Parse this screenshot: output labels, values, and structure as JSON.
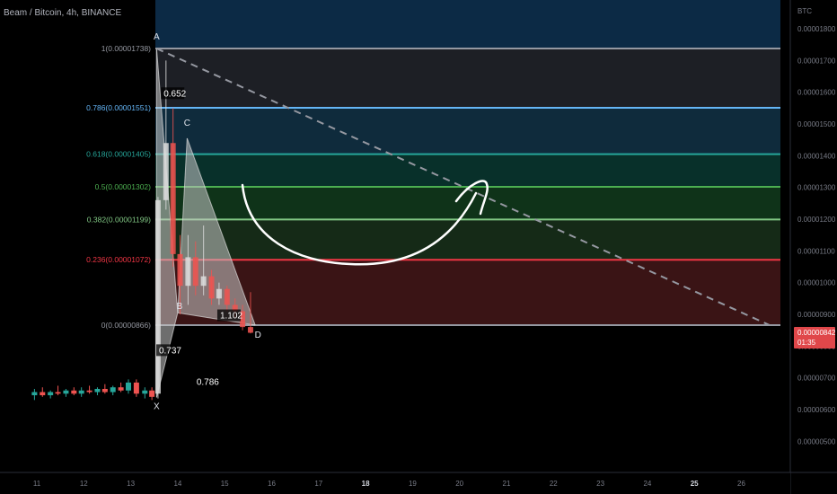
{
  "header": {
    "title": "Beam / Bitcoin, 4h, BINANCE",
    "currency": "BTC"
  },
  "price_badge": {
    "value": "0.00000842",
    "countdown": "01:35"
  },
  "chart_data": {
    "type": "candlestick",
    "title": "Beam / Bitcoin, 4h, BINANCE",
    "y_axis": {
      "unit": "BTC",
      "range": [
        4.5e-06,
        1.91e-05
      ],
      "ticks": [
        "0.00001800",
        "0.00001700",
        "0.00001600",
        "0.00001500",
        "0.00001400",
        "0.00001300",
        "0.00001200",
        "0.00001100",
        "0.00001000",
        "0.00000900",
        "0.00000800",
        "0.00000700",
        "0.00000600",
        "0.00000500"
      ],
      "tick_values": [
        1.8e-05,
        1.7e-05,
        1.6e-05,
        1.5e-05,
        1.4e-05,
        1.3e-05,
        1.2e-05,
        1.1e-05,
        1e-05,
        9e-06,
        8e-06,
        7e-06,
        6e-06,
        5e-06
      ]
    },
    "x_axis": {
      "ticks": [
        "11",
        "12",
        "13",
        "14",
        "15",
        "16",
        "17",
        "18",
        "19",
        "20",
        "21",
        "22",
        "23",
        "24",
        "25",
        "26"
      ],
      "bold_ticks": [
        "18",
        "25"
      ]
    },
    "fib_levels": [
      {
        "ratio": "1",
        "label": "1(0.00001738)",
        "price": 1.738e-05,
        "color": "#9598a1"
      },
      {
        "ratio": "0.786",
        "label": "0.786(0.00001551)",
        "price": 1.551e-05,
        "color": "#64b5f6"
      },
      {
        "ratio": "0.618",
        "label": "0.618(0.00001405)",
        "price": 1.405e-05,
        "color": "#26a69a"
      },
      {
        "ratio": "0.5",
        "label": "0.5(0.00001302)",
        "price": 1.302e-05,
        "color": "#4caf50"
      },
      {
        "ratio": "0.382",
        "label": "0.382(0.00001199)",
        "price": 1.199e-05,
        "color": "#81c784"
      },
      {
        "ratio": "0.236",
        "label": "0.236(0.00001072)",
        "price": 1.072e-05,
        "color": "#f23645"
      },
      {
        "ratio": "0",
        "label": "0(0.00000866)",
        "price": 8.66e-06,
        "color": "#9598a1"
      }
    ],
    "fib_zones": [
      {
        "from": 1.738e-05,
        "to": 1.91e-05,
        "color": "#0c2a45"
      },
      {
        "from": 1.551e-05,
        "to": 1.738e-05,
        "color": "#1d1f25"
      },
      {
        "from": 1.405e-05,
        "to": 1.551e-05,
        "color": "#0f2b3c"
      },
      {
        "from": 1.302e-05,
        "to": 1.405e-05,
        "color": "#08302a"
      },
      {
        "from": 1.199e-05,
        "to": 1.302e-05,
        "color": "#0f3319"
      },
      {
        "from": 1.072e-05,
        "to": 1.199e-05,
        "color": "#152a17"
      },
      {
        "from": 8.66e-06,
        "to": 1.072e-05,
        "color": "#3a1415"
      }
    ],
    "harmonic_pattern": {
      "points": [
        {
          "label": "X",
          "x": 13.55,
          "price": 6.38e-06
        },
        {
          "label": "A",
          "x": 13.55,
          "price": 1.738e-05
        },
        {
          "label": "B",
          "x": 14.0,
          "price": 9.05e-06
        },
        {
          "label": "C",
          "x": 14.2,
          "price": 1.455e-05
        },
        {
          "label": "D",
          "x": 15.65,
          "price": 8.66e-06
        }
      ],
      "ratios": [
        {
          "text": "0.652",
          "x": 13.7,
          "price": 1.59e-05
        },
        {
          "text": "0.737",
          "x": 13.6,
          "price": 7.8e-06
        },
        {
          "text": "0.786",
          "x": 14.4,
          "price": 6.8e-06
        },
        {
          "text": "1.102",
          "x": 14.9,
          "price": 8.9e-06
        }
      ]
    },
    "dashed_trendline": {
      "from": {
        "x": 13.55,
        "price": 1.738e-05
      },
      "to": {
        "x": 26.6,
        "price": 8.66e-06
      }
    },
    "candles": [
      {
        "x": 10.95,
        "o": 6.45,
        "h": 6.65,
        "l": 6.3,
        "c": 6.55
      },
      {
        "x": 11.12,
        "o": 6.55,
        "h": 6.7,
        "l": 6.4,
        "c": 6.45
      },
      {
        "x": 11.29,
        "o": 6.45,
        "h": 6.6,
        "l": 6.35,
        "c": 6.55
      },
      {
        "x": 11.45,
        "o": 6.55,
        "h": 6.75,
        "l": 6.45,
        "c": 6.5
      },
      {
        "x": 11.62,
        "o": 6.5,
        "h": 6.65,
        "l": 6.4,
        "c": 6.6
      },
      {
        "x": 11.79,
        "o": 6.6,
        "h": 6.7,
        "l": 6.45,
        "c": 6.5
      },
      {
        "x": 11.95,
        "o": 6.5,
        "h": 6.7,
        "l": 6.4,
        "c": 6.6
      },
      {
        "x": 12.12,
        "o": 6.6,
        "h": 6.75,
        "l": 6.5,
        "c": 6.55
      },
      {
        "x": 12.29,
        "o": 6.55,
        "h": 6.7,
        "l": 6.45,
        "c": 6.65
      },
      {
        "x": 12.45,
        "o": 6.65,
        "h": 6.8,
        "l": 6.5,
        "c": 6.55
      },
      {
        "x": 12.62,
        "o": 6.55,
        "h": 6.75,
        "l": 6.45,
        "c": 6.7
      },
      {
        "x": 12.79,
        "o": 6.7,
        "h": 6.85,
        "l": 6.55,
        "c": 6.6
      },
      {
        "x": 12.95,
        "o": 6.6,
        "h": 6.95,
        "l": 6.5,
        "c": 6.85
      },
      {
        "x": 13.12,
        "o": 6.85,
        "h": 6.95,
        "l": 6.4,
        "c": 6.5
      },
      {
        "x": 13.3,
        "o": 6.5,
        "h": 6.7,
        "l": 6.35,
        "c": 6.6
      },
      {
        "x": 13.45,
        "o": 6.6,
        "h": 6.7,
        "l": 6.3,
        "c": 6.4
      },
      {
        "x": 13.58,
        "o": 6.5,
        "h": 12.7,
        "l": 6.35,
        "c": 12.6
      },
      {
        "x": 13.75,
        "o": 12.6,
        "h": 17.0,
        "l": 12.3,
        "c": 14.4
      },
      {
        "x": 13.9,
        "o": 14.4,
        "h": 15.5,
        "l": 10.5,
        "c": 10.9
      },
      {
        "x": 14.05,
        "o": 10.9,
        "h": 11.5,
        "l": 9.0,
        "c": 9.9
      },
      {
        "x": 14.22,
        "o": 9.9,
        "h": 11.5,
        "l": 9.3,
        "c": 10.8
      },
      {
        "x": 14.38,
        "o": 10.8,
        "h": 11.3,
        "l": 9.6,
        "c": 9.9
      },
      {
        "x": 14.55,
        "o": 9.9,
        "h": 11.8,
        "l": 9.6,
        "c": 10.2
      },
      {
        "x": 14.72,
        "o": 10.2,
        "h": 10.4,
        "l": 9.3,
        "c": 9.5
      },
      {
        "x": 14.88,
        "o": 9.5,
        "h": 10.0,
        "l": 9.3,
        "c": 9.8
      },
      {
        "x": 15.05,
        "o": 9.8,
        "h": 9.9,
        "l": 9.1,
        "c": 9.3
      },
      {
        "x": 15.22,
        "o": 9.3,
        "h": 9.5,
        "l": 8.9,
        "c": 9.1
      },
      {
        "x": 15.38,
        "o": 9.1,
        "h": 9.3,
        "l": 8.5,
        "c": 8.6
      },
      {
        "x": 15.55,
        "o": 8.6,
        "h": 9.7,
        "l": 8.4,
        "c": 8.42
      }
    ],
    "price_scale_factor": 1e-06
  }
}
